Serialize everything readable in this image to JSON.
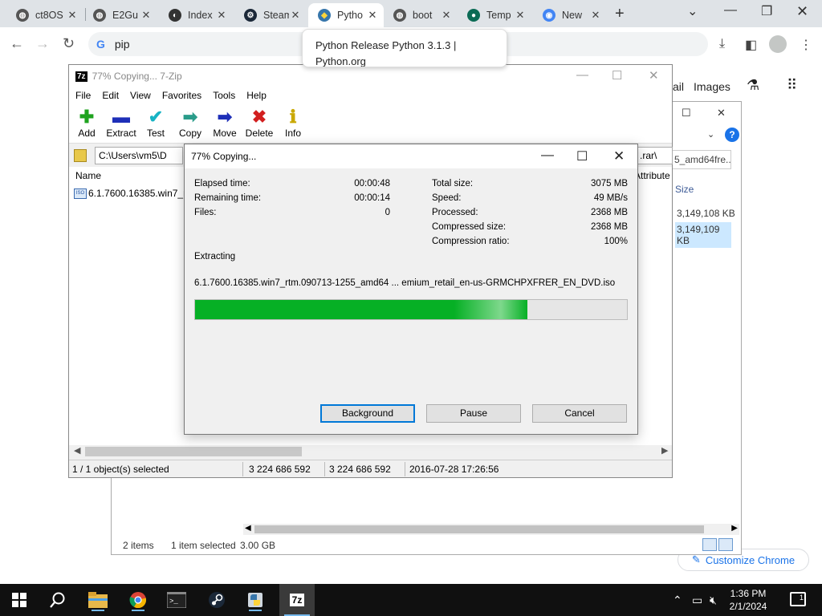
{
  "browser": {
    "tabs": [
      {
        "title": "ct8OS",
        "icon": "globe-icon"
      },
      {
        "title": "E2Gu",
        "icon": "globe-icon"
      },
      {
        "title": "Index",
        "icon": "eclipse-icon"
      },
      {
        "title": "Steam",
        "icon": "steam-icon"
      },
      {
        "title": "Pytho",
        "icon": "python-icon"
      },
      {
        "title": "boot",
        "icon": "globe-icon"
      },
      {
        "title": "Temp",
        "icon": "green-logo-icon"
      },
      {
        "title": "New",
        "icon": "chrome-icon"
      }
    ],
    "omnibox_text": "pip",
    "tooltip_text": "Python Release Python 3.1.3 | Python.org",
    "gbar": {
      "mail_partial": "ail",
      "images": "Images"
    },
    "customize_label": "Customize Chrome"
  },
  "explorer": {
    "address_partial": "5_amd64fre...",
    "col_size": "Size",
    "sizes": [
      "3,149,108 KB",
      "3,149,109 KB"
    ],
    "status": {
      "items": "2 items",
      "selected": "1 item selected",
      "size": "3.00 GB"
    }
  },
  "zip": {
    "title": "77% Copying... 7-Zip",
    "logo_text": "7z",
    "menu": [
      "File",
      "Edit",
      "View",
      "Favorites",
      "Tools",
      "Help"
    ],
    "toolbar": [
      {
        "label": "Add",
        "icon": "plus-icon",
        "color": "#1fa31f"
      },
      {
        "label": "Extract",
        "icon": "minus-icon",
        "color": "#1e2fb8"
      },
      {
        "label": "Test",
        "icon": "checkmark-icon",
        "color": "#17b3c4"
      },
      {
        "label": "Copy",
        "icon": "arrow-right-icon",
        "color": "#2a9c8a"
      },
      {
        "label": "Move",
        "icon": "arrow-right-icon",
        "color": "#1e2fb8"
      },
      {
        "label": "Delete",
        "icon": "x-icon",
        "color": "#d21f1f"
      },
      {
        "label": "Info",
        "icon": "info-icon",
        "color": "#c9a800"
      }
    ],
    "path": "C:\\Users\\vm5\\D",
    "path_right": ".rar\\",
    "col_name": "Name",
    "col_attr": "Attribute",
    "file_name": "6.1.7600.16385.win7_rtm",
    "status": {
      "selected": "1 / 1 object(s) selected",
      "size": "3 224 686 592",
      "packed": "3 224 686 592",
      "modified": "2016-07-28 17:26:56"
    }
  },
  "dialog": {
    "title": "77% Copying...",
    "left_stats": [
      {
        "label": "Elapsed time:",
        "value": "00:00:48"
      },
      {
        "label": "Remaining time:",
        "value": "00:00:14"
      },
      {
        "label": "Files:",
        "value": "0"
      }
    ],
    "right_stats": [
      {
        "label": "Total size:",
        "value": "3075 MB"
      },
      {
        "label": "Speed:",
        "value": "49 MB/s"
      },
      {
        "label": "Processed:",
        "value": "2368 MB"
      },
      {
        "label": "Compressed size:",
        "value": "2368 MB"
      },
      {
        "label": "Compression ratio:",
        "value": "100%"
      }
    ],
    "operation": "Extracting",
    "file": "6.1.7600.16385.win7_rtm.090713-1255_amd64 ... emium_retail_en-us-GRMCHPXFRER_EN_DVD.iso",
    "progress_percent": 77,
    "buttons": {
      "background": "Background",
      "pause": "Pause",
      "cancel": "Cancel"
    }
  },
  "taskbar": {
    "time": "1:36 PM",
    "date": "2/1/2024",
    "notification_count": "1"
  }
}
